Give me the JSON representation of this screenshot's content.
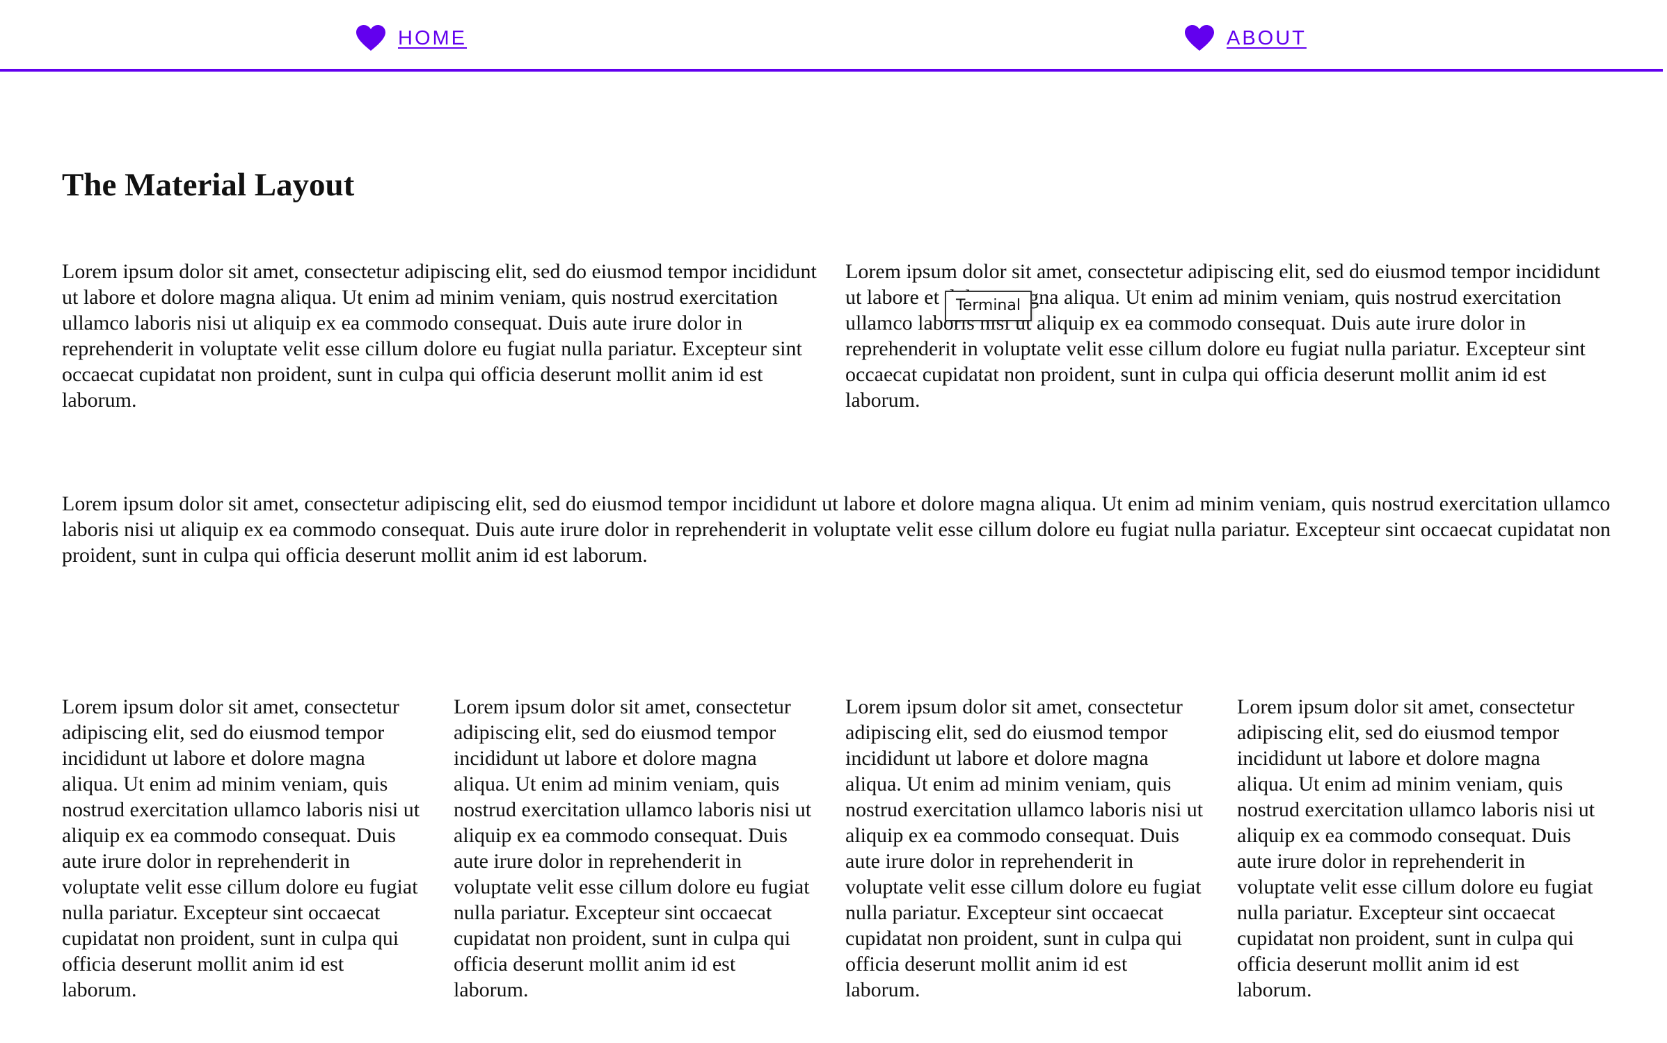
{
  "nav": {
    "accent_color": "#6200ee",
    "items": [
      {
        "label": "HOME",
        "icon": "heart-icon"
      },
      {
        "label": "ABOUT",
        "icon": "heart-icon"
      }
    ]
  },
  "main": {
    "title": "The Material Layout",
    "row1": [
      "Lorem ipsum dolor sit amet, consectetur adipiscing elit, sed do eiusmod tempor incididunt ut labore et dolore magna aliqua. Ut enim ad minim veniam, quis nostrud exercitation ullamco laboris nisi ut aliquip ex ea commodo consequat. Duis aute irure dolor in reprehenderit in voluptate velit esse cillum dolore eu fugiat nulla pariatur. Excepteur sint occaecat cupidatat non proident, sunt in culpa qui officia deserunt mollit anim id est laborum.",
      "Lorem ipsum dolor sit amet, consectetur adipiscing elit, sed do eiusmod tempor incididunt ut labore et dolore magna aliqua. Ut enim ad minim veniam, quis nostrud exercitation ullamco laboris nisi ut aliquip ex ea commodo consequat. Duis aute irure dolor in reprehenderit in voluptate velit esse cillum dolore eu fugiat nulla pariatur. Excepteur sint occaecat cupidatat non proident, sunt in culpa qui officia deserunt mollit anim id est laborum."
    ],
    "row2": "Lorem ipsum dolor sit amet, consectetur adipiscing elit, sed do eiusmod tempor incididunt ut labore et dolore magna aliqua. Ut enim ad minim veniam, quis nostrud exercitation ullamco laboris nisi ut aliquip ex ea commodo consequat. Duis aute irure dolor in reprehenderit in voluptate velit esse cillum dolore eu fugiat nulla pariatur. Excepteur sint occaecat cupidatat non proident, sunt in culpa qui officia deserunt mollit anim id est laborum.",
    "row3": [
      "Lorem ipsum dolor sit amet, consectetur adipiscing elit, sed do eiusmod tempor incididunt ut labore et dolore magna aliqua. Ut enim ad minim veniam, quis nostrud exercitation ullamco laboris nisi ut aliquip ex ea commodo consequat. Duis aute irure dolor in reprehenderit in voluptate velit esse cillum dolore eu fugiat nulla pariatur. Excepteur sint occaecat cupidatat non proident, sunt in culpa qui officia deserunt mollit anim id est laborum.",
      "Lorem ipsum dolor sit amet, consectetur adipiscing elit, sed do eiusmod tempor incididunt ut labore et dolore magna aliqua. Ut enim ad minim veniam, quis nostrud exercitation ullamco laboris nisi ut aliquip ex ea commodo consequat. Duis aute irure dolor in reprehenderit in voluptate velit esse cillum dolore eu fugiat nulla pariatur. Excepteur sint occaecat cupidatat non proident, sunt in culpa qui officia deserunt mollit anim id est laborum.",
      "Lorem ipsum dolor sit amet, consectetur adipiscing elit, sed do eiusmod tempor incididunt ut labore et dolore magna aliqua. Ut enim ad minim veniam, quis nostrud exercitation ullamco laboris nisi ut aliquip ex ea commodo consequat. Duis aute irure dolor in reprehenderit in voluptate velit esse cillum dolore eu fugiat nulla pariatur. Excepteur sint occaecat cupidatat non proident, sunt in culpa qui officia deserunt mollit anim id est laborum.",
      "Lorem ipsum dolor sit amet, consectetur adipiscing elit, sed do eiusmod tempor incididunt ut labore et dolore magna aliqua. Ut enim ad minim veniam, quis nostrud exercitation ullamco laboris nisi ut aliquip ex ea commodo consequat. Duis aute irure dolor in reprehenderit in voluptate velit esse cillum dolore eu fugiat nulla pariatur. Excepteur sint occaecat cupidatat non proident, sunt in culpa qui officia deserunt mollit anim id est laborum."
    ]
  },
  "tooltip": {
    "text": "Terminal"
  }
}
